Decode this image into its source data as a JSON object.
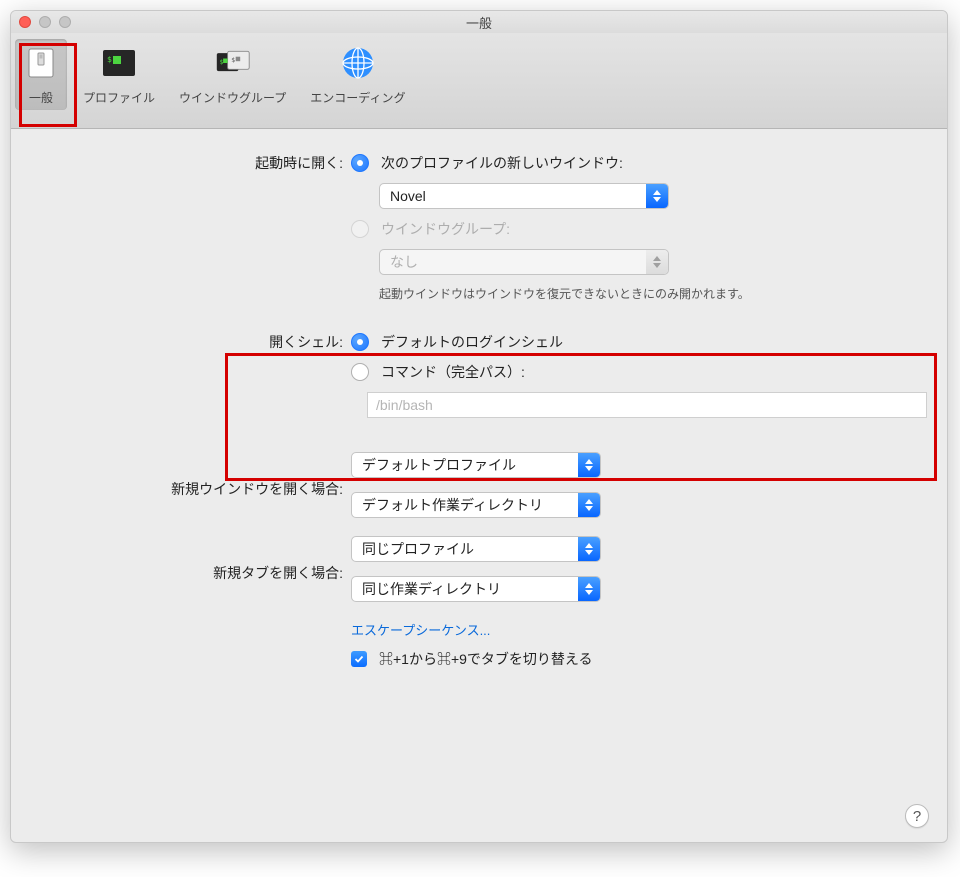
{
  "window": {
    "title": "一般"
  },
  "toolbar": {
    "items": [
      {
        "label": "一般"
      },
      {
        "label": "プロファイル"
      },
      {
        "label": "ウインドウグループ"
      },
      {
        "label": "エンコーディング"
      }
    ]
  },
  "startup": {
    "label": "起動時に開く:",
    "option_new_window": "次のプロファイルの新しいウインドウ:",
    "profile_select_value": "Novel",
    "option_group": "ウインドウグループ:",
    "group_select_value": "なし",
    "hint": "起動ウインドウはウインドウを復元できないときにのみ開かれます。"
  },
  "shell": {
    "label": "開くシェル:",
    "option_default": "デフォルトのログインシェル",
    "option_command": "コマンド（完全パス）:",
    "command_placeholder": "/bin/bash"
  },
  "new_window": {
    "label": "新規ウインドウを開く場合:",
    "profile_value": "デフォルトプロファイル",
    "dir_value": "デフォルト作業ディレクトリ"
  },
  "new_tab": {
    "label": "新規タブを開く場合:",
    "profile_value": "同じプロファイル",
    "dir_value": "同じ作業ディレクトリ"
  },
  "escape_link": "エスケープシーケンス...",
  "cmd_switch": "⌘+1から⌘+9でタブを切り替える",
  "help": "?"
}
